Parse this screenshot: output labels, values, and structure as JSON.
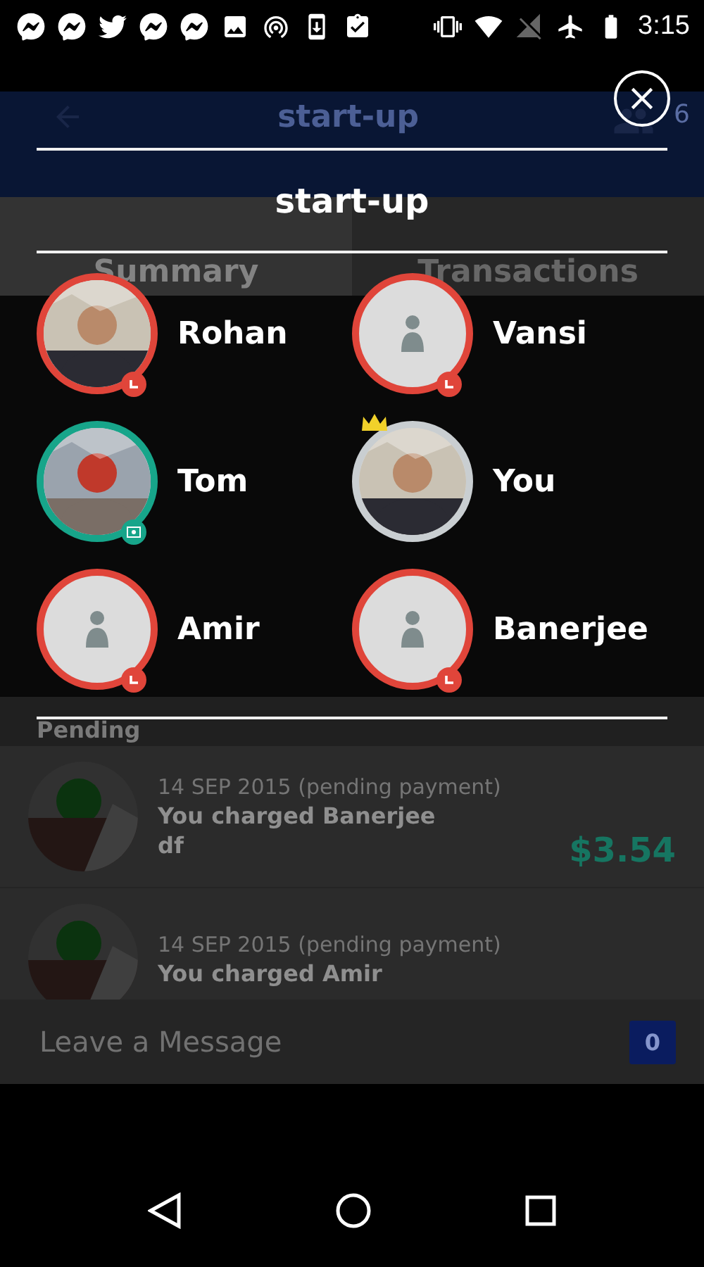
{
  "status_bar": {
    "time": "3:15"
  },
  "app_bar": {
    "title": "start-up",
    "member_count": "6"
  },
  "tabs": [
    {
      "label": "Summary",
      "selected": true
    },
    {
      "label": "Transactions",
      "selected": false
    }
  ],
  "pending": {
    "heading": "Pending",
    "items": [
      {
        "date": "14 SEP 2015 (pending payment)",
        "title": "You charged Banerjee",
        "note": "df",
        "amount": "$3.54"
      },
      {
        "date": "14 SEP 2015 (pending payment)",
        "title": "You charged Amir"
      }
    ]
  },
  "message_bar": {
    "placeholder": "Leave a Message",
    "count": "0"
  },
  "group_dialog": {
    "title": "start-up",
    "members": [
      {
        "name": "Rohan",
        "color": "#e0453a",
        "kind": "picture",
        "pending": true,
        "paid": false,
        "crown": false
      },
      {
        "name": "Vansi",
        "color": "#e0453a",
        "kind": "placeholder",
        "pending": true,
        "paid": false,
        "crown": false
      },
      {
        "name": "Tom",
        "color": "#17a58a",
        "kind": "picture",
        "pending": false,
        "paid": true,
        "crown": false
      },
      {
        "name": "You",
        "color": "#c9ced1",
        "kind": "picture",
        "pending": false,
        "paid": false,
        "crown": true
      },
      {
        "name": "Amir",
        "color": "#e0453a",
        "kind": "placeholder",
        "pending": true,
        "paid": false,
        "crown": false
      },
      {
        "name": "Banerjee",
        "color": "#e0453a",
        "kind": "placeholder",
        "pending": true,
        "paid": false,
        "crown": false
      }
    ]
  }
}
